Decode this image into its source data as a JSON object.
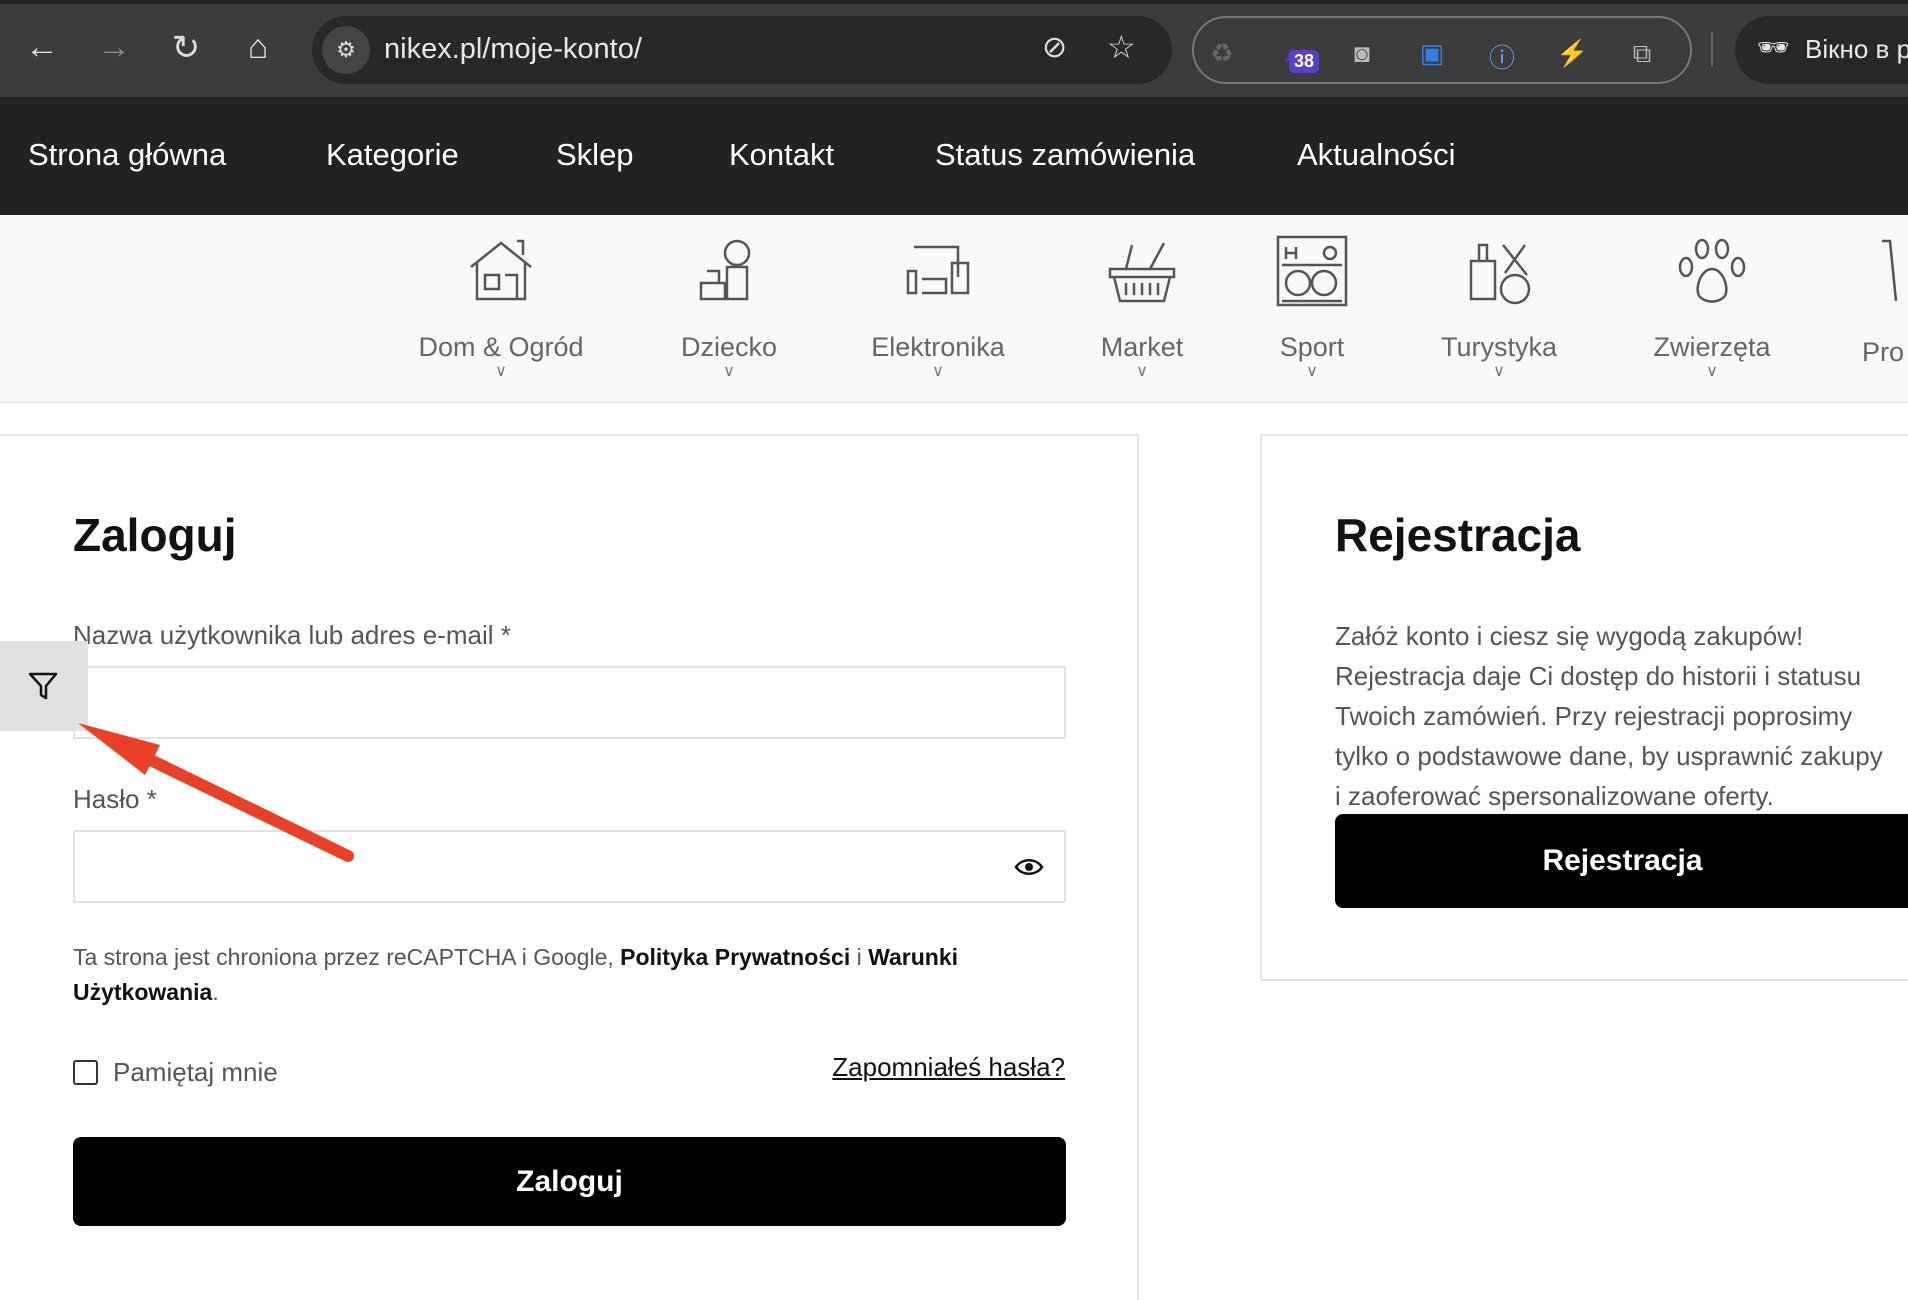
{
  "browser": {
    "url": "nikex.pl/moje-konto/",
    "extension_badge": "38",
    "incognito_label": "Вікно в р"
  },
  "nav": {
    "items": [
      "Strona główna",
      "Kategorie",
      "Sklep",
      "Kontakt",
      "Status zamówienia",
      "Aktualności"
    ]
  },
  "categories": [
    {
      "label": "Dom & Ogród",
      "icon": "house-icon"
    },
    {
      "label": "Dziecko",
      "icon": "child-icon"
    },
    {
      "label": "Elektronika",
      "icon": "devices-icon"
    },
    {
      "label": "Market",
      "icon": "basket-icon"
    },
    {
      "label": "Sport",
      "icon": "sport-shelf-icon"
    },
    {
      "label": "Turystyka",
      "icon": "luggage-plane-icon"
    },
    {
      "label": "Zwierzęta",
      "icon": "paw-icon"
    },
    {
      "label": "Pro",
      "icon": "tool-icon"
    }
  ],
  "login": {
    "title": "Zaloguj",
    "username_label": "Nazwa użytkownika lub adres e-mail *",
    "username_value": "",
    "password_label": "Hasło *",
    "password_value": "",
    "recaptcha_pre": "Ta strona jest chroniona przez reCAPTCHA i Google, ",
    "privacy": "Polityka Prywatności",
    "and": " i ",
    "terms": "Warunki Użytkowania",
    "dot": ".",
    "remember": "Pamiętaj mnie",
    "forgot": "Zapomniałeś hasła?",
    "submit": "Zaloguj"
  },
  "register": {
    "title": "Rejestracja",
    "text": "Załóż konto i ciesz się wygodą zakupów! Rejestracja daje Ci dostęp do historii i statusu Twoich zamówień. Przy rejestracji poprosimy tylko o podstawowe dane, by usprawnić zakupy i zaoferować spersonalizowane oferty.",
    "button": "Rejestracja"
  },
  "annotation": {
    "arrow_color": "#e94128"
  }
}
